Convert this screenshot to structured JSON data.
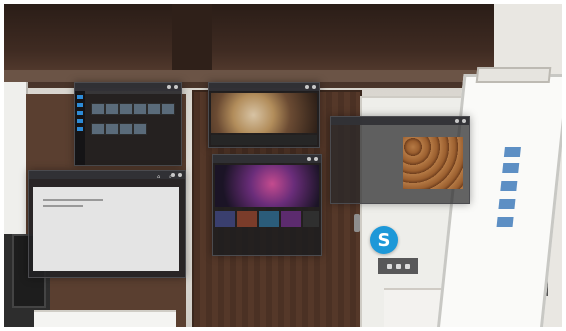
{
  "scene": {
    "photos_app": {
      "side_icons": 5,
      "thumbs": 10
    },
    "edge_app": {
      "title": "",
      "tool_labels": [
        "",
        ""
      ]
    },
    "food_app": {
      "hero_label": ""
    },
    "movies_app": {
      "hero_label": "",
      "tiles": 5
    },
    "almonds_app": {
      "header": "",
      "title": ""
    },
    "skype_app": {
      "icon": "S"
    }
  }
}
